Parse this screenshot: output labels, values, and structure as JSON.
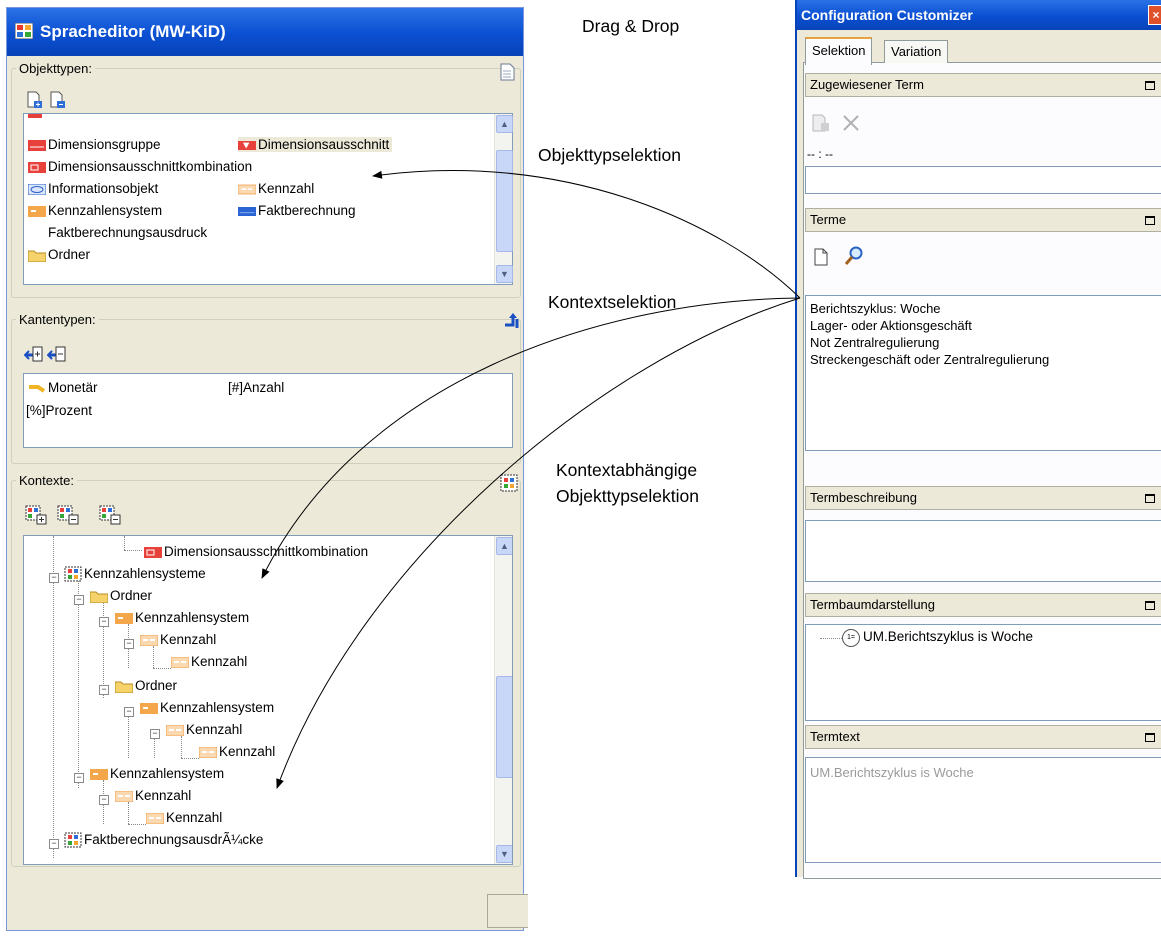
{
  "annotations": {
    "drag_drop": "Drag & Drop",
    "objekttypselektion": "Objekttypselektion",
    "kontextselektion": "Kontextselektion",
    "kontextabhaengige_line1": "Kontextabhängige",
    "kontextabhaengige_line2": "Objekttypselektion"
  },
  "left_window": {
    "title": "Spracheditor (MW-KiD)",
    "objekttypen": {
      "legend": "Objekttypen:",
      "items": [
        {
          "label": "Dimensionsgruppe",
          "icon": "dimensionsgruppe-icon"
        },
        {
          "label": "Dimensionsausschnitt",
          "icon": "dimensionsausschnitt-icon"
        },
        {
          "label": "Dimensionsausschnittkombination",
          "icon": "dimensionsausschnittkombination-icon"
        },
        {
          "label": "Informationsobjekt",
          "icon": "informationsobjekt-icon"
        },
        {
          "label": "Kennzahl",
          "icon": "kennzahl-icon"
        },
        {
          "label": "Kennzahlensystem",
          "icon": "kennzahlensystem-icon"
        },
        {
          "label": "Faktberechnung",
          "icon": "faktberechnung-icon"
        },
        {
          "label": "Faktberechnungsausdruck",
          "icon": ""
        },
        {
          "label": "Ordner",
          "icon": "folder-icon"
        }
      ]
    },
    "kantentypen": {
      "legend": "Kantentypen:",
      "items": [
        {
          "label": "Monetär",
          "icon": "monetaer-icon"
        },
        {
          "label": "Anzahl",
          "prefix": "[#]"
        },
        {
          "label": "Prozent",
          "prefix": "[%]"
        }
      ]
    },
    "kontexte": {
      "legend": "Kontexte:",
      "tree": [
        {
          "label": "Dimensionsausschnittkombination"
        },
        {
          "label": "Kennzahlensysteme"
        },
        {
          "label": "Ordner"
        },
        {
          "label": "Kennzahlensystem"
        },
        {
          "label": "Kennzahl"
        },
        {
          "label": "Kennzahl"
        },
        {
          "label": "Ordner"
        },
        {
          "label": "Kennzahlensystem"
        },
        {
          "label": "Kennzahl"
        },
        {
          "label": "Kennzahl"
        },
        {
          "label": "Kennzahlensystem"
        },
        {
          "label": "Kennzahl"
        },
        {
          "label": "Kennzahl"
        },
        {
          "label": "FaktberechnungsausdrÃ¼cke"
        }
      ]
    },
    "plus_minus": "−"
  },
  "right_window": {
    "title": "Configuration Customizer",
    "close": "×",
    "tabs": [
      "Selektion",
      "Variation"
    ],
    "zugewiesener_term": {
      "header": "Zugewiesener Term",
      "value_label": "-- : --",
      "input_value": ""
    },
    "terme": {
      "header": "Terme",
      "items": [
        "Berichtszyklus: Woche",
        "Lager- oder Aktionsgeschäft",
        "Not Zentralregulierung",
        "Streckengeschäft oder Zentralregulierung"
      ]
    },
    "termbeschreibung": {
      "header": "Termbeschreibung",
      "text": ""
    },
    "termbaumdarstellung": {
      "header": "Termbaumdarstellung",
      "node_label": "UM.Berichtszyklus is Woche",
      "node_symbol": "1="
    },
    "termtext": {
      "header": "Termtext",
      "text": "UM.Berichtszyklus is Woche"
    }
  }
}
